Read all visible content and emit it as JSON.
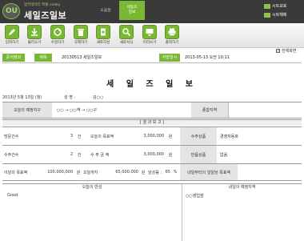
{
  "header": {
    "logo_glyph": "OU",
    "logo_subtitle": "업무데이터 엑셀 codey",
    "app_title": "세일즈일보",
    "tab_help": "도움말",
    "tab_active": "세일즈\n일보",
    "sheet_save": "시트보호",
    "sheet_release": "시트해제"
  },
  "toolbar": {
    "items": [
      {
        "label": "입력하기",
        "icon": "pencil-icon"
      },
      {
        "label": "불러오기",
        "icon": "import-icon"
      },
      {
        "label": "수정하기",
        "icon": "refresh-icon"
      },
      {
        "label": "삭제하기",
        "icon": "trash-icon"
      },
      {
        "label": "새로작성",
        "icon": "new-document-icon"
      },
      {
        "label": "새로서식",
        "icon": "search-icon"
      },
      {
        "label": "미리보기",
        "icon": "monitor-icon"
      },
      {
        "label": "출력하기",
        "icon": "printer-icon"
      }
    ],
    "fullscreen_label": "전체화면",
    "fullscreen_checked": "✓"
  },
  "meta": {
    "doc_number_label": "문서정보",
    "title_label": "제목",
    "title_value": "20130513 세일즈일보",
    "saved_label": "저장일시",
    "saved_value": "2013-05-13  오전 10:11"
  },
  "report": {
    "title": "세 일 즈 일 보",
    "date": "2013년 5월 13일 (월)",
    "author_label": "성  명 :",
    "author_value": "김○○",
    "today_region_label": "오늘의 예정지구",
    "today_region_value": "○○ → ○○역 → ○○구",
    "total_region_label": "종합지역",
    "result_header": "[ 결 과 보 고 ]",
    "visit_count_label": "방문건수",
    "visit_count_value": "3",
    "visit_count_unit": "건",
    "today_target_label": "오늘의 목표액",
    "today_target_value": "3,000,000",
    "won": "원",
    "order_product_label": "수주상품",
    "order_product_value": "경영자동화",
    "order_count_label": "수주건수",
    "order_count_value": "2",
    "order_count_unit": "건",
    "order_amount_label": "수 주 금 액",
    "order_amount_value": "3,000,000",
    "return_product_label": "반품상품",
    "return_product_value": "없음",
    "month_target_label": "이달의 목표액",
    "month_target_value": "100,000,000",
    "cumulative_label": "오늘까지",
    "cumulative_value": "65,000,000",
    "achieve_label": "달성률 :",
    "achieve_value": "65",
    "achieve_unit": "%",
    "from_tomorrow_label": "내일부터의 일일당 목표액",
    "today_review_label": "오늘의 반성",
    "today_review_value": "Good",
    "tomorrow_plan_label": "내일의 예정지역",
    "tomorrow_plan_value": "○○영업점"
  },
  "colors": {
    "accent": "#7ab834",
    "header_bg": "#3a3a3a"
  }
}
